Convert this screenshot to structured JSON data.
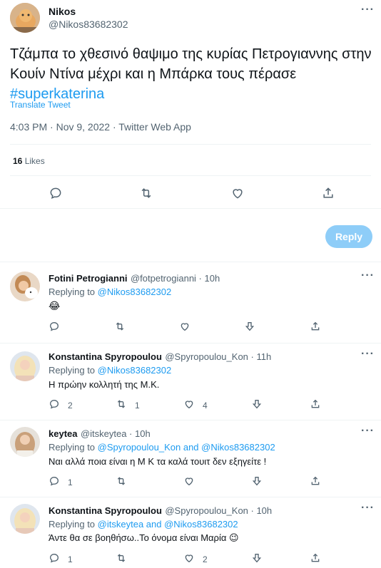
{
  "main_tweet": {
    "author_name": "Nikos",
    "author_handle": "@Nikos83682302",
    "text": "Τζάμπα το  χθεσινό θαψιμο της κυρίας Πετρογιαννης στην Κουίν Ντίνα μέχρι και η Μπάρκα τους πέρασε",
    "hashtag": "#superkaterina",
    "translate_label": "Translate Tweet",
    "timestamp": "4:03 PM · Nov 9, 2022 · Twitter Web App",
    "likes_count": "16",
    "likes_label": "Likes"
  },
  "reply_box": {
    "button_label": "Reply"
  },
  "replies": [
    {
      "author_name": "Fotini Petrogianni",
      "meta": "@fotpetrogianni · 10h",
      "replying_prefix": "Replying to",
      "replying_to": "@Nikos83682302",
      "text": "😂",
      "counts": {
        "reply": "",
        "retweet": "",
        "like": ""
      }
    },
    {
      "author_name": "Konstantina Spyropoulou",
      "meta": "@Spyropoulou_Kon · 11h",
      "replying_prefix": "Replying to",
      "replying_to": "@Nikos83682302",
      "text": "Η πρώην κολλητή της Μ.Κ.",
      "counts": {
        "reply": "2",
        "retweet": "1",
        "like": "4"
      }
    },
    {
      "author_name": "keytea",
      "meta": "@itskeytea · 10h",
      "replying_prefix": "Replying to",
      "replying_to": "@Spyropoulou_Kon and @Nikos83682302",
      "text": "Ναι αλλά ποια είναι η Μ Κ τα καλά τουιτ δεν εξηγείτε !",
      "counts": {
        "reply": "1",
        "retweet": "",
        "like": ""
      }
    },
    {
      "author_name": "Konstantina Spyropoulou",
      "meta": "@Spyropoulou_Kon · 10h",
      "replying_prefix": "Replying to",
      "replying_to": "@itskeytea and @Nikos83682302",
      "text": "Άντε θα σε βοηθήσω..Το όνομα είναι Μαρία 😉",
      "counts": {
        "reply": "1",
        "retweet": "",
        "like": "2"
      }
    }
  ],
  "colors": {
    "accent": "#1d9bf0",
    "reply_button_disabled": "#8ecdf8",
    "secondary_text": "#536471"
  }
}
